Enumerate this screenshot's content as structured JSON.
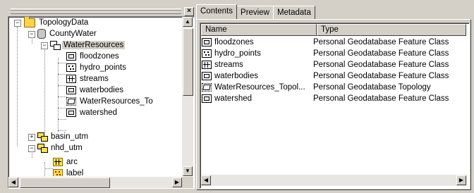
{
  "left_panel": {
    "close_glyph": "×",
    "tree": [
      {
        "label": "TopologyData",
        "icon": "folder-icon",
        "expander": "−"
      },
      {
        "label": "CountyWater",
        "icon": "database-icon",
        "expander": "−"
      },
      {
        "label": "WaterResources",
        "icon": "feature-dataset-icon",
        "expander": "−",
        "selected": true
      },
      {
        "label": "floodzones",
        "icon": "polygon-feature-class-icon"
      },
      {
        "label": "hydro_points",
        "icon": "point-feature-class-icon"
      },
      {
        "label": "streams",
        "icon": "line-feature-class-icon"
      },
      {
        "label": "waterbodies",
        "icon": "polygon-feature-class-icon"
      },
      {
        "label": "WaterResources_To",
        "icon": "topology-icon"
      },
      {
        "label": "watershed",
        "icon": "polygon-feature-class-icon"
      },
      {
        "label": "basin_utm",
        "icon": "coverage-icon",
        "expander": "+"
      },
      {
        "label": "nhd_utm",
        "icon": "coverage-icon",
        "expander": "−"
      },
      {
        "label": "arc",
        "icon": "arc-icon"
      },
      {
        "label": "label",
        "icon": "label-icon"
      }
    ]
  },
  "right_panel": {
    "tabs": [
      "Contents",
      "Preview",
      "Metadata"
    ],
    "active_tab": "Contents",
    "columns": [
      "Name",
      "Type"
    ],
    "rows": [
      {
        "name": "floodzones",
        "type": "Personal Geodatabase Feature Class",
        "icon": "polygon-feature-class-icon"
      },
      {
        "name": "hydro_points",
        "type": "Personal Geodatabase Feature Class",
        "icon": "point-feature-class-icon"
      },
      {
        "name": "streams",
        "type": "Personal Geodatabase Feature Class",
        "icon": "line-feature-class-icon"
      },
      {
        "name": "waterbodies",
        "type": "Personal Geodatabase Feature Class",
        "icon": "polygon-feature-class-icon"
      },
      {
        "name": "WaterResources_Topol...",
        "type": "Personal Geodatabase Topology",
        "icon": "topology-icon"
      },
      {
        "name": "watershed",
        "type": "Personal Geodatabase Feature Class",
        "icon": "polygon-feature-class-icon"
      }
    ]
  },
  "scroll_glyphs": {
    "up": "▲",
    "down": "▼",
    "left": "◀",
    "right": "▶"
  }
}
